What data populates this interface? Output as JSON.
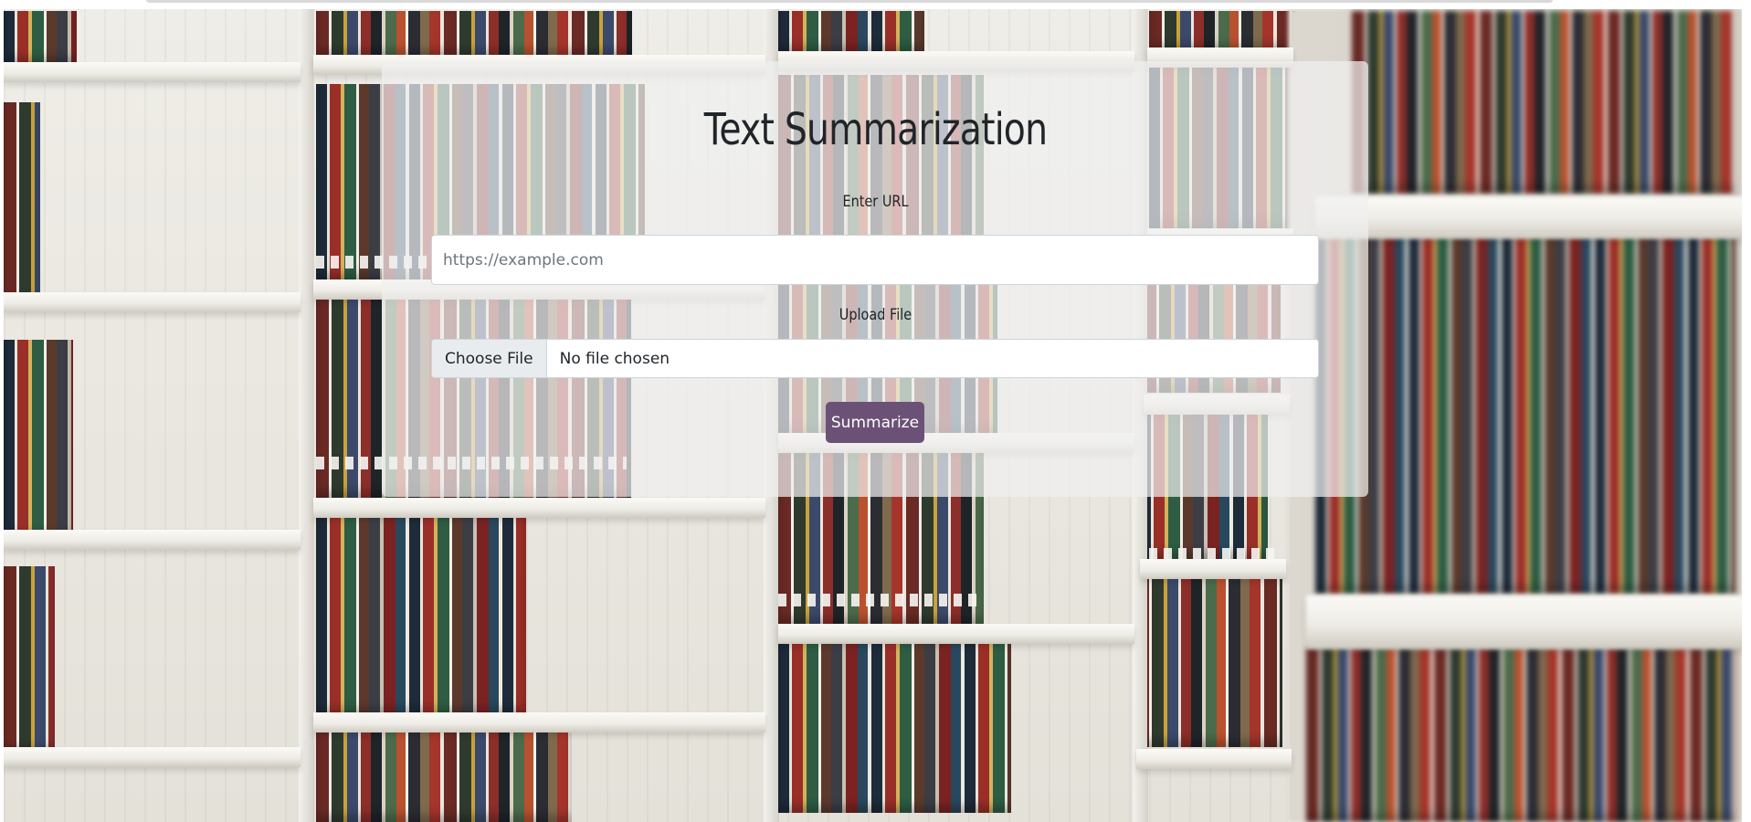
{
  "page": {
    "title": "Text Summarization"
  },
  "form": {
    "url_label": "Enter URL",
    "url_placeholder": "https://example.com",
    "url_value": "",
    "file_label": "Upload File",
    "file_button_label": "Choose File",
    "file_status": "No file chosen",
    "submit_label": "Summarize"
  },
  "colors": {
    "button_background": "#6b5176",
    "card_background": "rgba(240,240,240,0.72)",
    "title_text": "#212529"
  },
  "background": {
    "description_icon": "library-bookshelves-image"
  }
}
